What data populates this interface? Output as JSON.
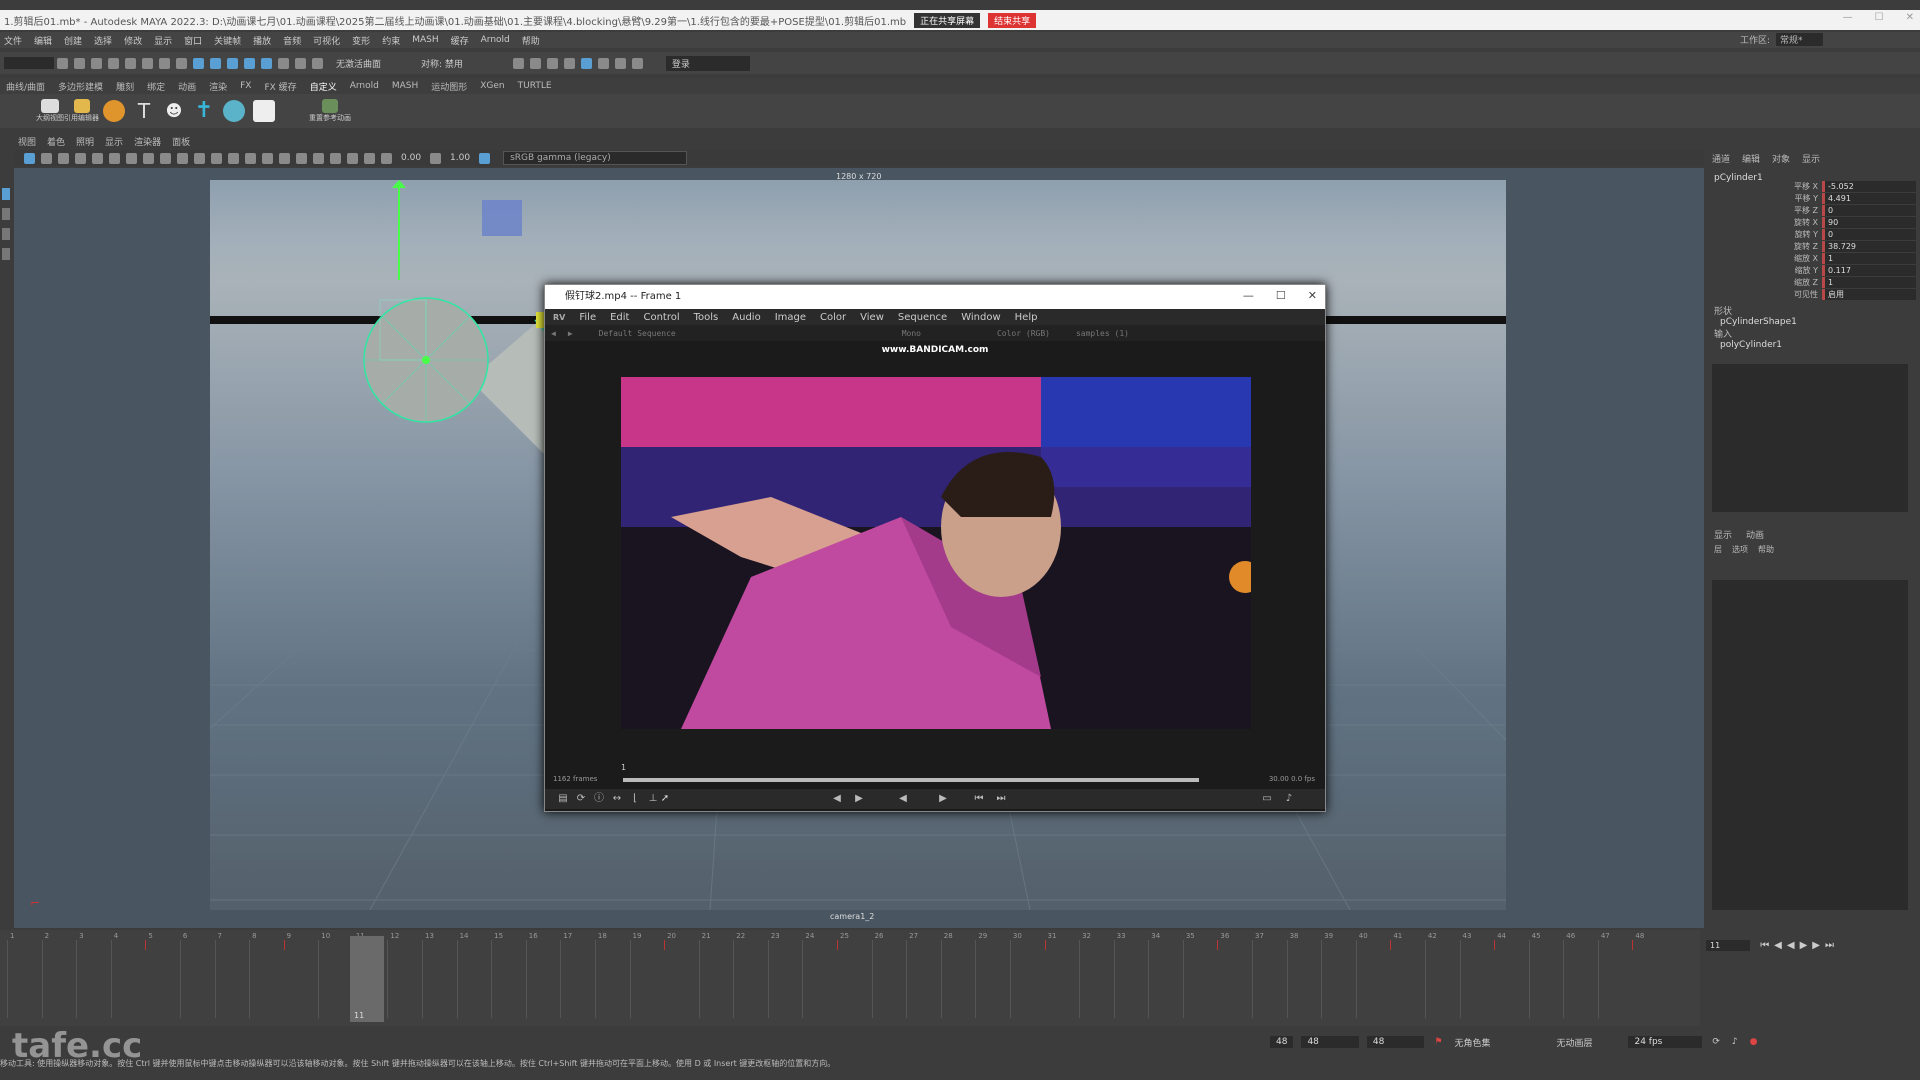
{
  "app": {
    "title": "1.剪辑后01.mb* - Autodesk MAYA 2022.3: D:\\动画课七月\\01.动画课程\\2025第二届线上动画课\\01.动画基础\\01.主要课程\\4.blocking\\悬臂\\9.29第一\\1.线行包含的要最+POSE提型\\01.剪辑后01.mb",
    "share_label": "正在共享屏幕",
    "stop_share_label": "结束共享",
    "workspace_label": "工作区:",
    "workspace_value": "常规*"
  },
  "menubar": [
    "文件",
    "编辑",
    "创建",
    "选择",
    "修改",
    "显示",
    "窗口",
    "关键帧",
    "播放",
    "音频",
    "可视化",
    "变形",
    "约束",
    "MASH",
    "缓存",
    "Arnold",
    "帮助"
  ],
  "toolbar": {
    "mode_label": "无激活曲面",
    "symmetry_label": "对称: 禁用",
    "login_label": "登录"
  },
  "shelf_tabs": [
    "曲线/曲面",
    "多边形建模",
    "雕刻",
    "绑定",
    "动画",
    "渲染",
    "FX",
    "FX 缓存",
    "自定义",
    "Arnold",
    "MASH",
    "运动图形",
    "XGen",
    "TURTLE"
  ],
  "shelf_active": "自定义",
  "shelf_labels": [
    "大纲视图",
    "引用编辑器",
    "重置参考动画"
  ],
  "panel_menu": [
    "视图",
    "着色",
    "照明",
    "显示",
    "渲染器",
    "面板"
  ],
  "viewport": {
    "gamma": "sRGB gamma (legacy)",
    "value_a": "0.00",
    "value_b": "1.00",
    "resolution": "1280 x 720",
    "camera": "camera1_2"
  },
  "channel_box": {
    "tabs": [
      "通道",
      "编辑",
      "对象",
      "显示"
    ],
    "object": "pCylinder1",
    "attributes": [
      {
        "label": "平移 X",
        "value": "-5.052"
      },
      {
        "label": "平移 Y",
        "value": "4.491"
      },
      {
        "label": "平移 Z",
        "value": "0"
      },
      {
        "label": "旋转 X",
        "value": "90"
      },
      {
        "label": "旋转 Y",
        "value": "0"
      },
      {
        "label": "旋转 Z",
        "value": "38.729"
      },
      {
        "label": "缩放 X",
        "value": "1"
      },
      {
        "label": "缩放 Y",
        "value": "0.117"
      },
      {
        "label": "缩放 Z",
        "value": "1"
      },
      {
        "label": "可见性",
        "value": "启用"
      }
    ],
    "shapes_label": "形状",
    "shape": "pCylinderShape1",
    "inputs_label": "输入",
    "input": "polyCylinder1",
    "layer_tabs": [
      "显示",
      "动画"
    ],
    "layer_menu": [
      "层",
      "选项",
      "帮助"
    ]
  },
  "timeline": {
    "ticks": [
      "1",
      "2",
      "3",
      "4",
      "5",
      "6",
      "7",
      "8",
      "9",
      "10",
      "11",
      "12",
      "13",
      "14",
      "15",
      "16",
      "17",
      "18",
      "19",
      "20",
      "21",
      "22",
      "23",
      "24",
      "25",
      "26",
      "27",
      "28",
      "29",
      "30",
      "31",
      "32",
      "33",
      "34",
      "35",
      "36",
      "37",
      "38",
      "39",
      "40",
      "41",
      "42",
      "43",
      "44",
      "45",
      "46",
      "47",
      "48"
    ],
    "current_frame": "11",
    "keyframes": [
      5,
      9,
      20,
      25,
      31,
      36,
      41,
      44,
      48
    ]
  },
  "range": {
    "end_a": "48",
    "end_b": "48",
    "end_c": "48",
    "char_set": "无角色集",
    "anim_layer": "无动画层",
    "fps": "24 fps"
  },
  "help_line": "移动工具: 使用操纵器移动对象。按住 Ctrl 键并使用鼠标中键点击移动操纵器可以沿该轴移动对象。按住 Shift 键并拖动操纵器可以在该轴上移动。按住 Ctrl+Shift 键并拖动可在平面上移动。使用 D 或 Insert 键更改枢轴的位置和方向。",
  "watermark": "tafe.cc",
  "rv": {
    "title": "假钉球2.mp4 -- Frame 1",
    "menu_logo": "RV",
    "menu": [
      "File",
      "Edit",
      "Control",
      "Tools",
      "Audio",
      "Image",
      "Color",
      "View",
      "Sequence",
      "Window",
      "Help"
    ],
    "sequence": "Default Sequence",
    "mono": "Mono",
    "color": "Color (RGB)",
    "samples": "samples (1)",
    "bandicam": "www.BANDICAM.com",
    "frames_label": "1162 frames",
    "frame_num": "1",
    "fps_label": "30.00 0.0 fps"
  }
}
